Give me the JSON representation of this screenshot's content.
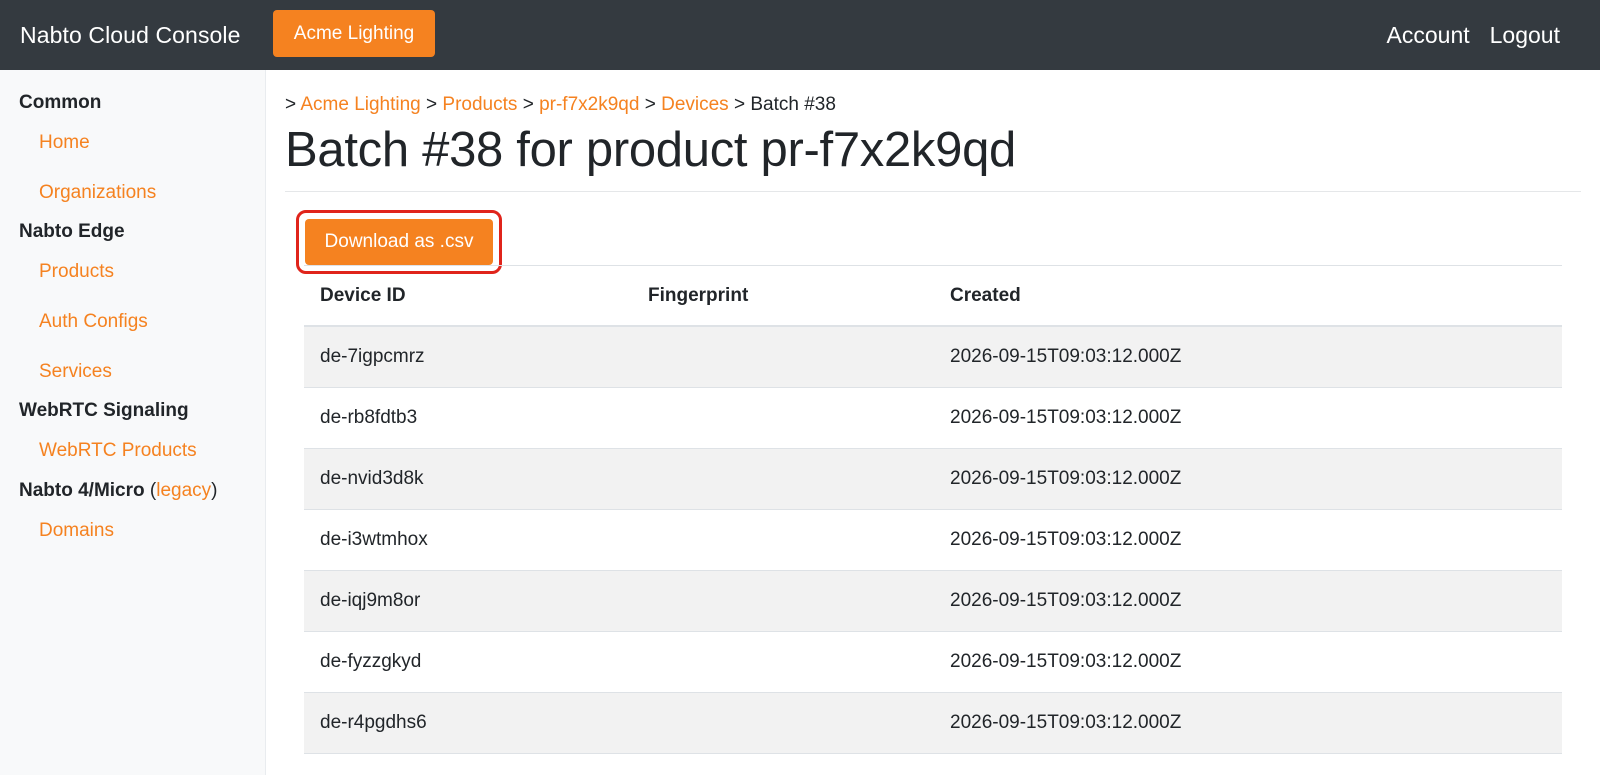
{
  "navbar": {
    "brand": "Nabto Cloud Console",
    "org_button": "Acme Lighting",
    "account": "Account",
    "logout": "Logout"
  },
  "sidebar": {
    "sections": [
      {
        "title": "Common"
      },
      {
        "title": "Nabto Edge"
      },
      {
        "title": "WebRTC Signaling"
      },
      {
        "title": "Nabto 4/Micro",
        "paren_open": "(",
        "legacy": "legacy",
        "paren_close": ")"
      }
    ],
    "items": [
      {
        "label": "Home"
      },
      {
        "label": "Organizations"
      },
      {
        "label": "Products"
      },
      {
        "label": "Auth Configs"
      },
      {
        "label": "Services"
      },
      {
        "label": "WebRTC Products"
      },
      {
        "label": "Domains"
      }
    ]
  },
  "breadcrumb": {
    "sep": ">",
    "items": [
      "Acme Lighting",
      "Products",
      "pr-f7x2k9qd",
      "Devices"
    ],
    "current": "Batch #38"
  },
  "page": {
    "title": "Batch #38 for product pr-f7x2k9qd",
    "download_label": "Download as .csv"
  },
  "table": {
    "headers": [
      "Device ID",
      "Fingerprint",
      "Created"
    ],
    "rows": [
      {
        "device_id": "de-7igpcmrz",
        "fingerprint": "",
        "created": "2026-09-15T09:03:12.000Z"
      },
      {
        "device_id": "de-rb8fdtb3",
        "fingerprint": "",
        "created": "2026-09-15T09:03:12.000Z"
      },
      {
        "device_id": "de-nvid3d8k",
        "fingerprint": "",
        "created": "2026-09-15T09:03:12.000Z"
      },
      {
        "device_id": "de-i3wtmhox",
        "fingerprint": "",
        "created": "2026-09-15T09:03:12.000Z"
      },
      {
        "device_id": "de-iqj9m8or",
        "fingerprint": "",
        "created": "2026-09-15T09:03:12.000Z"
      },
      {
        "device_id": "de-fyzzgkyd",
        "fingerprint": "",
        "created": "2026-09-15T09:03:12.000Z"
      },
      {
        "device_id": "de-r4pgdhs6",
        "fingerprint": "",
        "created": "2026-09-15T09:03:12.000Z"
      }
    ]
  },
  "colors": {
    "accent": "#f58220",
    "navbar": "#343a40",
    "highlight": "#e0241b"
  }
}
